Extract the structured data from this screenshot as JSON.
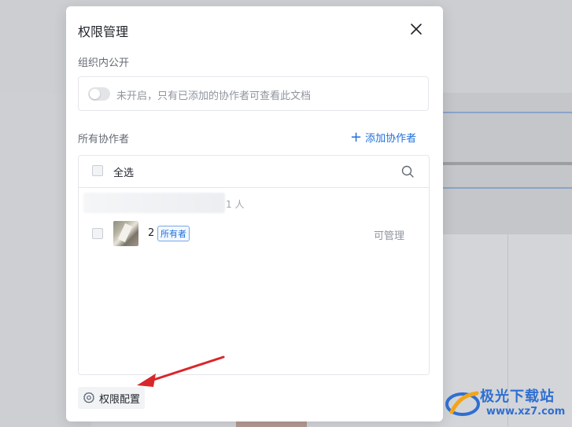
{
  "dialog": {
    "title": "权限管理",
    "org_public_label": "组织内公开",
    "org_public_toggle_text": "未开启，只有已添加的协作者可查看此文档",
    "collaborators_label": "所有协作者",
    "add_collaborator_label": "添加协作者",
    "select_all_label": "全选",
    "group_count": "1 人",
    "members": [
      {
        "name": "2",
        "badge": "所有者",
        "permission": "可管理"
      }
    ],
    "config_button_label": "权限配置"
  },
  "watermark": {
    "brand": "极光下载站",
    "url": "www.xz7.com"
  },
  "colors": {
    "accent": "#1f6fd9",
    "arrow": "#d9262b"
  }
}
